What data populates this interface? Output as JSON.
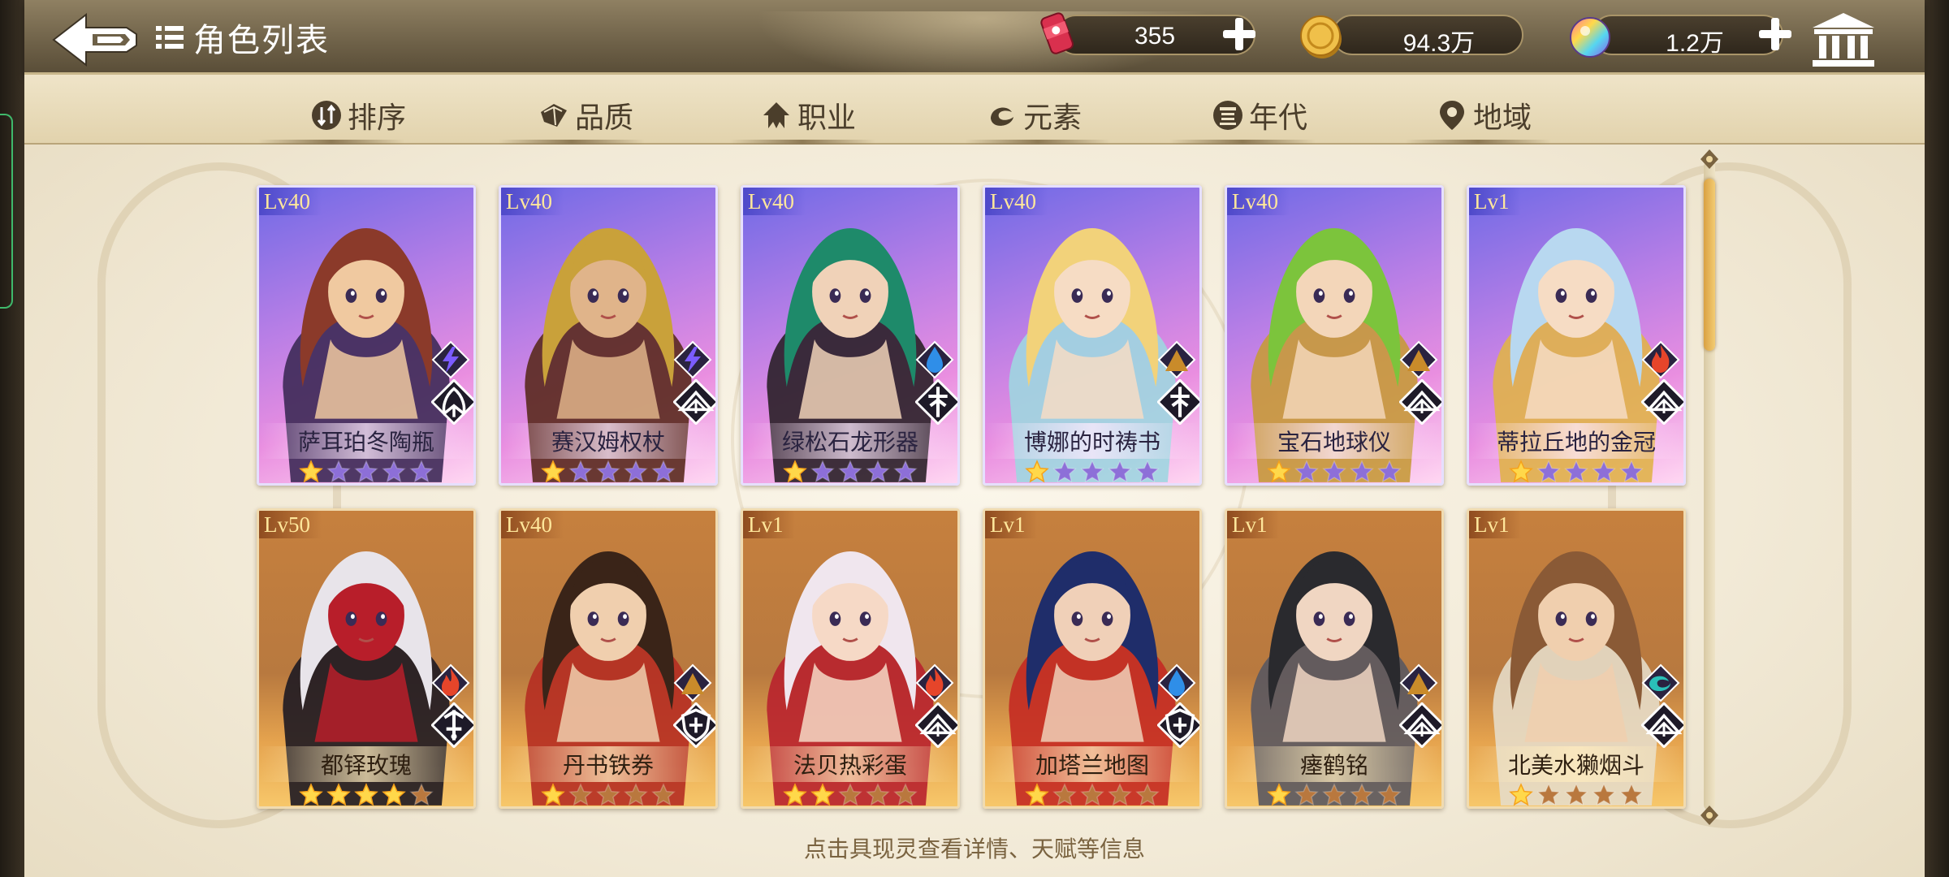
{
  "header": {
    "title": "角色列表",
    "currencies": [
      {
        "name": "energy-can",
        "value": "355",
        "color": "#d9304e"
      },
      {
        "name": "gold-coin",
        "value": "94.3万",
        "color": "#e8b23a"
      },
      {
        "name": "rainbow-gem",
        "value": "1.2万",
        "color": "#b070e0"
      }
    ]
  },
  "filters": [
    {
      "label": "排序",
      "icon": "sort-icon"
    },
    {
      "label": "品质",
      "icon": "quality-icon"
    },
    {
      "label": "职业",
      "icon": "class-icon"
    },
    {
      "label": "元素",
      "icon": "element-icon"
    },
    {
      "label": "年代",
      "icon": "era-icon"
    },
    {
      "label": "地域",
      "icon": "location-pin-icon"
    }
  ],
  "cards": [
    {
      "level": "Lv40",
      "name": "萨耳珀冬陶瓶",
      "stars": 1,
      "max_stars": 5,
      "rarity": "purple",
      "element": "lightning",
      "role": "fan-class",
      "palette": [
        "#8b3a2a",
        "#3d2a56",
        "#f0c9a0"
      ]
    },
    {
      "level": "Lv40",
      "name": "赛汉姆权杖",
      "stars": 1,
      "max_stars": 5,
      "rarity": "purple",
      "element": "lightning",
      "role": "book-class",
      "palette": [
        "#c9a13a",
        "#5a2a1e",
        "#e0b48a"
      ]
    },
    {
      "level": "Lv40",
      "name": "绿松石龙形器",
      "stars": 1,
      "max_stars": 5,
      "rarity": "purple",
      "element": "water",
      "role": "cross-class",
      "palette": [
        "#1e8a6a",
        "#2a2028",
        "#f0d2b8"
      ]
    },
    {
      "level": "Lv40",
      "name": "博娜的时祷书",
      "stars": 1,
      "max_stars": 5,
      "rarity": "purple",
      "element": "earth",
      "role": "cross-class",
      "palette": [
        "#f2d27a",
        "#9fd6e0",
        "#f6dcc4"
      ]
    },
    {
      "level": "Lv40",
      "name": "宝石地球仪",
      "stars": 1,
      "max_stars": 5,
      "rarity": "purple",
      "element": "earth",
      "role": "book-class",
      "palette": [
        "#7cc43c",
        "#c79a3a",
        "#f3d6b9"
      ]
    },
    {
      "level": "Lv1",
      "name": "蒂拉丘地的金冠",
      "stars": 1,
      "max_stars": 5,
      "rarity": "purple",
      "element": "fire",
      "role": "book-class",
      "palette": [
        "#b8d8f0",
        "#e0b24a",
        "#f6dcc4"
      ]
    },
    {
      "level": "Lv50",
      "name": "都铎玫瑰",
      "stars": 4,
      "max_stars": 5,
      "rarity": "gold",
      "element": "fire",
      "role": "sword-class",
      "palette": [
        "#e8e4ea",
        "#1e1a22",
        "#b81e2a"
      ]
    },
    {
      "level": "Lv40",
      "name": "丹书铁券",
      "stars": 1,
      "max_stars": 5,
      "rarity": "gold",
      "element": "earth",
      "role": "shield-class",
      "palette": [
        "#3a2418",
        "#b52e22",
        "#f0cfae"
      ]
    },
    {
      "level": "Lv1",
      "name": "法贝热彩蛋",
      "stars": 2,
      "max_stars": 5,
      "rarity": "gold",
      "element": "fire",
      "role": "book-class",
      "palette": [
        "#f0e6ee",
        "#b8222e",
        "#f6d9c6"
      ]
    },
    {
      "level": "Lv1",
      "name": "加塔兰地图",
      "stars": 1,
      "max_stars": 5,
      "rarity": "gold",
      "element": "water",
      "role": "shield-class",
      "palette": [
        "#1f2d6a",
        "#c42a22",
        "#f0d0b8"
      ]
    },
    {
      "level": "Lv1",
      "name": "瘗鹤铭",
      "stars": 1,
      "max_stars": 5,
      "rarity": "gold",
      "element": "earth",
      "role": "book-class",
      "palette": [
        "#2a2a2e",
        "#5a5860",
        "#f0d6c2"
      ]
    },
    {
      "level": "Lv1",
      "name": "北美水獭烟斗",
      "stars": 1,
      "max_stars": 5,
      "rarity": "gold",
      "element": "wind",
      "role": "book-class",
      "palette": [
        "#8a5a36",
        "#e6dcc8",
        "#f0cfae"
      ]
    }
  ],
  "hint": "点击具现灵查看详情、天赋等信息",
  "scroll": {
    "position": 0.0,
    "visible_fraction": 0.27
  }
}
